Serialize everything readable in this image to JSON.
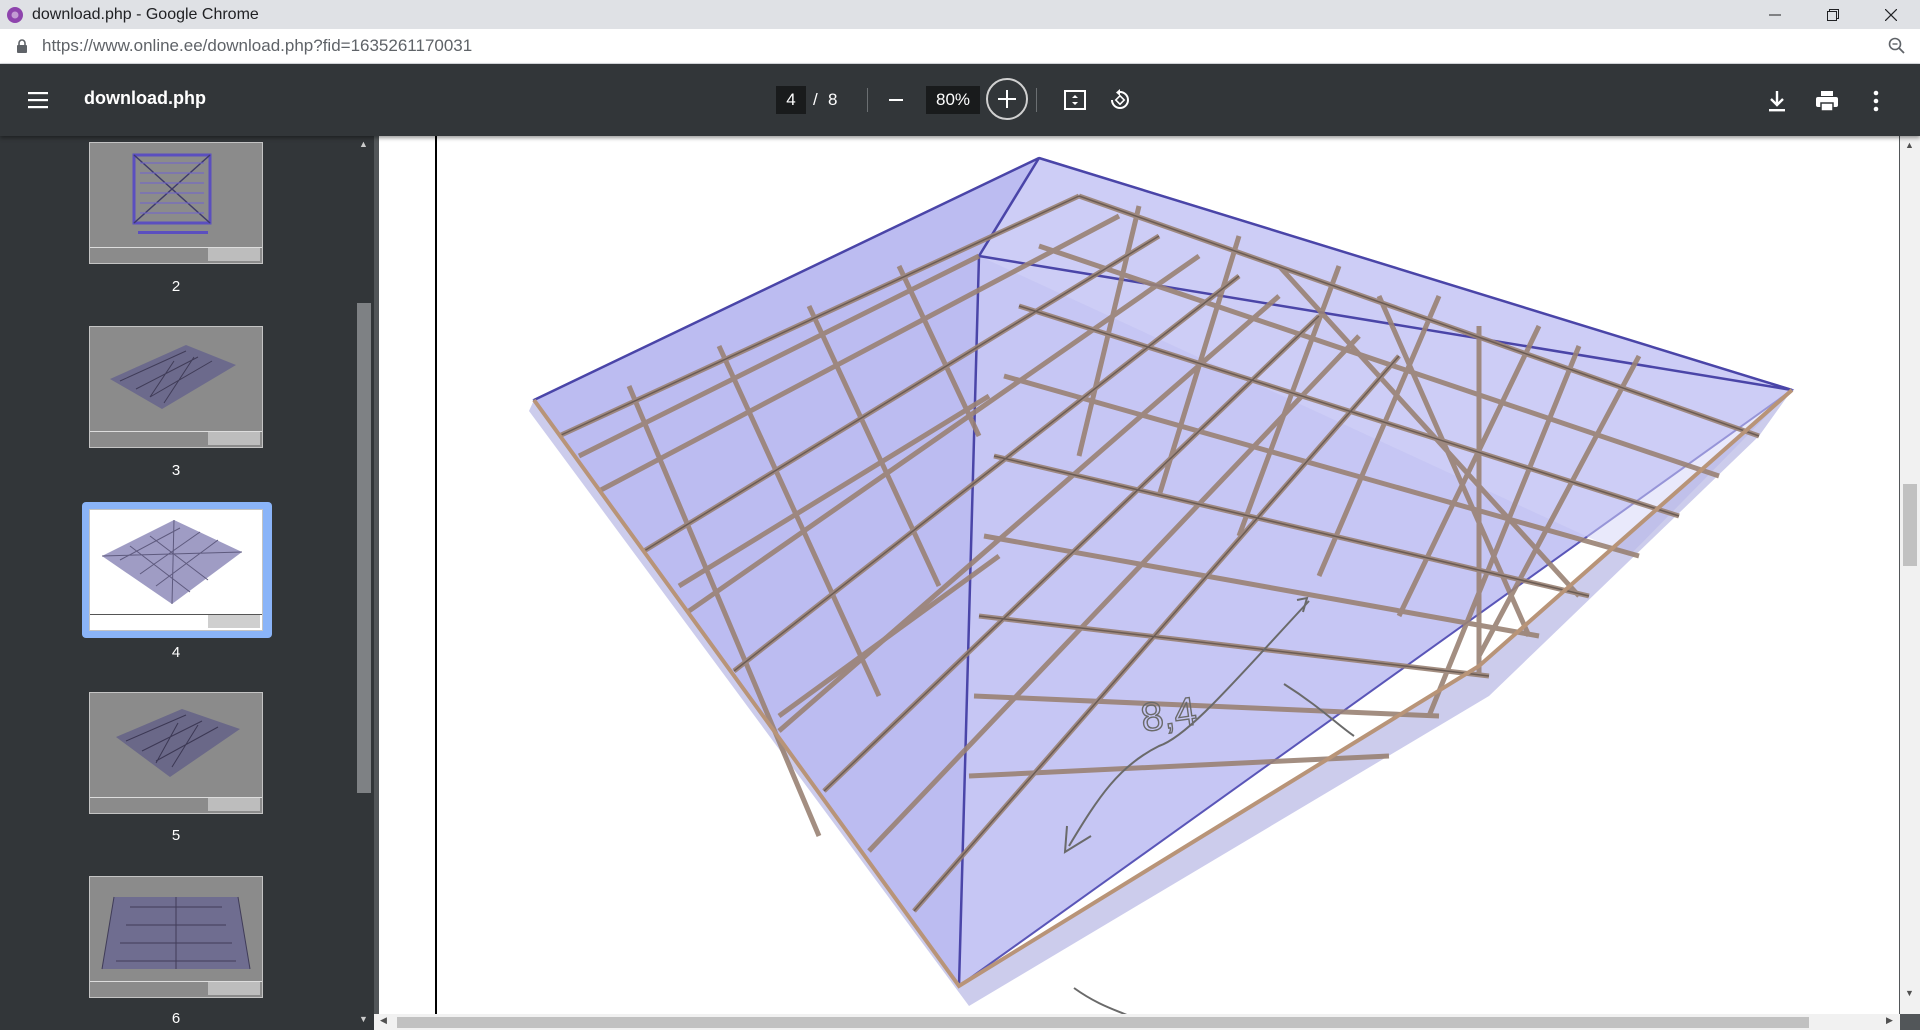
{
  "window": {
    "title": "download.php - Google Chrome",
    "url": "https://www.online.ee/download.php?fid=1635261170031"
  },
  "toolbar": {
    "doc_title": "download.php",
    "current_page": "4",
    "page_separator": "/",
    "total_pages": "8",
    "zoom": "80%"
  },
  "thumbnails": [
    {
      "label": "2"
    },
    {
      "label": "3"
    },
    {
      "label": "4",
      "selected": true
    },
    {
      "label": "5"
    },
    {
      "label": "6"
    }
  ],
  "annotation": {
    "handwritten_value": "8,4"
  },
  "colors": {
    "toolbar_bg": "#323639",
    "viewer_bg": "#525659",
    "selection": "#8ab4f8",
    "roof_panel": "#b8b8f2",
    "timber": "#9a8274"
  }
}
